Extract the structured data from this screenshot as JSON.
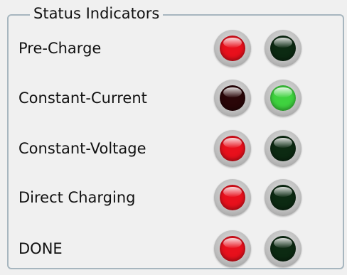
{
  "panel": {
    "title": "Status Indicators"
  },
  "rows": [
    {
      "label": "Pre-Charge",
      "indicators": [
        {
          "state": "on",
          "color": "red",
          "fill": "#e8101c"
        },
        {
          "state": "off",
          "color": "green",
          "fill": "#0c2a12"
        }
      ]
    },
    {
      "label": "Constant-Current",
      "indicators": [
        {
          "state": "off",
          "color": "red",
          "fill": "#2a0608"
        },
        {
          "state": "on",
          "color": "green",
          "fill": "#3fd23f"
        }
      ]
    },
    {
      "label": "Constant-Voltage",
      "indicators": [
        {
          "state": "on",
          "color": "red",
          "fill": "#e8101c"
        },
        {
          "state": "off",
          "color": "green",
          "fill": "#0c2a12"
        }
      ]
    },
    {
      "label": "Direct Charging",
      "indicators": [
        {
          "state": "on",
          "color": "red",
          "fill": "#e8101c"
        },
        {
          "state": "off",
          "color": "green",
          "fill": "#0c2a12"
        }
      ]
    },
    {
      "label": "DONE",
      "indicators": [
        {
          "state": "on",
          "color": "red",
          "fill": "#e8101c"
        },
        {
          "state": "off",
          "color": "green",
          "fill": "#0c2a12"
        }
      ]
    }
  ]
}
